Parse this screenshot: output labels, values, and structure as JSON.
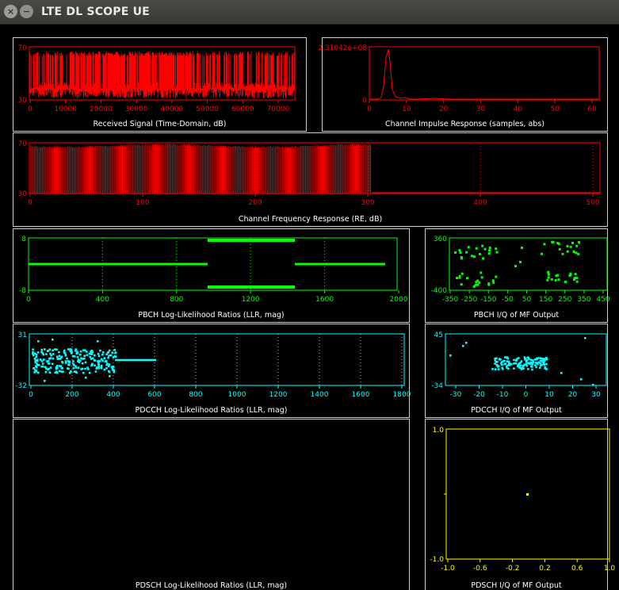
{
  "window": {
    "title": "LTE DL SCOPE UE",
    "close_glyph": "×",
    "minimize_glyph": "−"
  },
  "panels": {
    "received_signal": {
      "caption": "Received Signal (Time-Domain, dB)",
      "color": "#ff0000",
      "ylabels": [
        "70",
        "30"
      ],
      "xticks": [
        "0",
        "10000",
        "20000",
        "30000",
        "40000",
        "50000",
        "60000",
        "70000"
      ]
    },
    "impulse": {
      "caption": "Channel Impulse Response (samples, abs)",
      "color": "#ff0000",
      "ylabels": [
        "2.31042e+08",
        "0"
      ],
      "xticks": [
        "0",
        "10",
        "20",
        "30",
        "40",
        "50",
        "60"
      ]
    },
    "freq_resp": {
      "caption": "Channel Frequency Response (RE, dB)",
      "color": "#ff0000",
      "ylabels": [
        "70",
        "30"
      ],
      "xticks": [
        "0",
        "100",
        "200",
        "300",
        "400",
        "500"
      ]
    },
    "pbch_llr": {
      "caption": "PBCH Log-Likelihood Ratios (LLR, mag)",
      "color": "#00ff00",
      "ylabels": [
        "8",
        "-8"
      ],
      "xticks": [
        "0",
        "400",
        "800",
        "1200",
        "1600",
        "2000"
      ]
    },
    "pbch_iq": {
      "caption": "PBCH I/Q of MF Output",
      "color": "#00ff00",
      "ylabels": [
        "360",
        "-400"
      ],
      "xticks": [
        "-350",
        "-250",
        "-150",
        "-50",
        "50",
        "150",
        "250",
        "350",
        "450"
      ]
    },
    "pdcch_llr": {
      "caption": "PDCCH Log-Likelihood Ratios (LLR, mag)",
      "color": "#00ffff",
      "ylabels": [
        "31",
        "-32"
      ],
      "xticks": [
        "0",
        "200",
        "400",
        "600",
        "800",
        "1000",
        "1200",
        "1400",
        "1600",
        "1800"
      ]
    },
    "pdcch_iq": {
      "caption": "PDCCH I/Q of MF Output",
      "color": "#00ffff",
      "ylabels": [
        "45",
        "-34"
      ],
      "xticks": [
        "-30",
        "-20",
        "-10",
        "0",
        "10",
        "20",
        "30"
      ]
    },
    "pdsch_llr": {
      "caption": "PDSCH Log-Likelihood Ratios (LLR, mag)"
    },
    "pdsch_iq": {
      "caption": "PDSCH I/Q of MF Output",
      "color": "#ffff00",
      "ylabels": [
        "1.0",
        "-1.0"
      ],
      "xticks": [
        "-1.0",
        "-0.6",
        "-0.2",
        "0.2",
        "0.6",
        "1.0"
      ]
    }
  }
}
